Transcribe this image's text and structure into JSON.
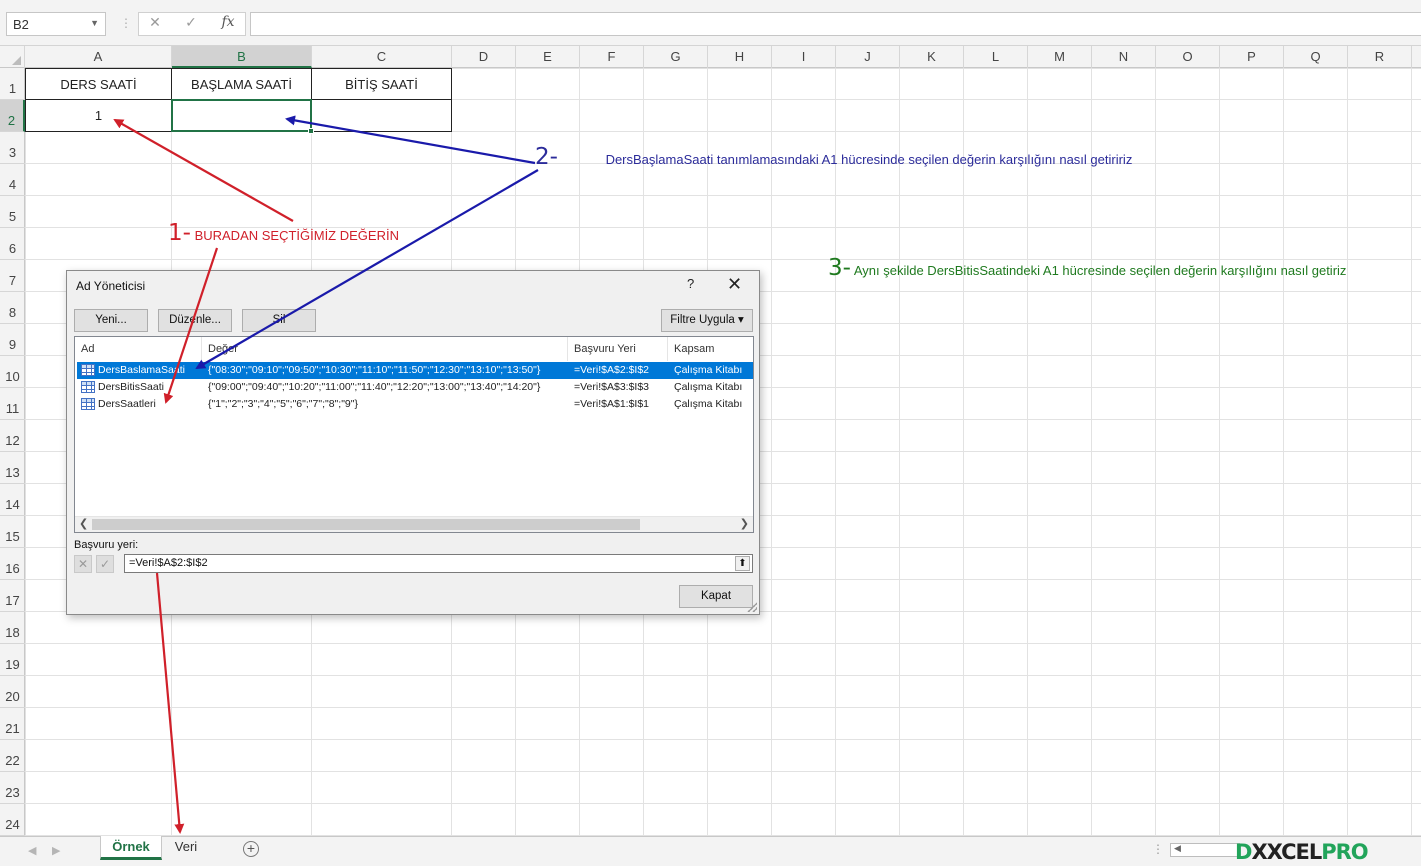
{
  "formula_bar": {
    "name_box": "B2",
    "cancel_glyph": "✕",
    "enter_glyph": "✓",
    "fx_label": "fx",
    "formula_value": ""
  },
  "columns": [
    "A",
    "B",
    "C",
    "D",
    "E",
    "F",
    "G",
    "H",
    "I",
    "J",
    "K",
    "L",
    "M",
    "N",
    "O",
    "P",
    "Q",
    "R"
  ],
  "selected_column": "B",
  "rows": [
    "1",
    "2",
    "3",
    "4",
    "5",
    "6",
    "7",
    "8",
    "9",
    "10",
    "11",
    "12",
    "13",
    "14",
    "15",
    "16",
    "17",
    "18",
    "19",
    "20",
    "21",
    "22",
    "23",
    "24"
  ],
  "selected_row": "2",
  "cells": {
    "A1": "DERS SAATİ",
    "B1": "BAŞLAMA SAATİ",
    "C1": "BİTİŞ SAATİ",
    "A2": "1",
    "B2": "",
    "C2": ""
  },
  "annotations": {
    "note1_number": "1-",
    "note1_text": "BURADAN SEÇTİĞİMİZ DEĞERİN",
    "note1_color": "#d0202a",
    "note2_number": "2-",
    "note2_text": "DersBaşlamaSaati tanımlamasındaki A1 hücresinde seçilen değerin karşılığını nasıl getiririz",
    "note2_color": "#2b2b9a",
    "note3_number": "3-",
    "note3_text": "Aynı şekilde DersBitisSaatindeki A1 hücresinde seçilen değerin karşılığını nasıl getiriz",
    "note3_color": "#1f7a1f",
    "arrow_red": "#d0202a",
    "arrow_blue": "#1a1aaa"
  },
  "dialog": {
    "title": "Ad Yöneticisi",
    "help": "?",
    "close": "✕",
    "buttons": {
      "new": "Yeni...",
      "edit": "Düzenle...",
      "delete": "Sil",
      "filter": "Filtre Uygula ▾",
      "close": "Kapat"
    },
    "columns": [
      "Ad",
      "Değer",
      "Başvuru Yeri",
      "Kapsam"
    ],
    "rows": [
      {
        "name": "DersBaslamaSaati",
        "value": "{\"08:30\";\"09:10\";\"09:50\";\"10:30\";\"11:10\";\"11:50\";\"12:30\";\"13:10\";\"13:50\"}",
        "ref": "=Veri!$A$2:$I$2",
        "scope": "Çalışma Kitabı"
      },
      {
        "name": "DersBitisSaati",
        "value": "{\"09:00\";\"09:40\";\"10:20\";\"11:00\";\"11:40\";\"12:20\";\"13:00\";\"13:40\";\"14:20\"}",
        "ref": "=Veri!$A$3:$I$3",
        "scope": "Çalışma Kitabı"
      },
      {
        "name": "DersSaatleri",
        "value": "{\"1\";\"2\";\"3\";\"4\";\"5\";\"6\";\"7\";\"8\";\"9\"}",
        "ref": "=Veri!$A$1:$I$1",
        "scope": "Çalışma Kitabı"
      }
    ],
    "selected_row": 0,
    "ref_label": "Başvuru yeri:",
    "ref_value": "=Veri!$A$2:$I$2",
    "ref_cancel": "✕",
    "ref_ok": "✓",
    "ref_collapse": "⬆"
  },
  "sheet_tabs": {
    "tabs": [
      "Örnek",
      "Veri"
    ],
    "active": "Örnek",
    "add": "+",
    "nav_prev": "◀",
    "nav_next": "▶"
  },
  "watermark": {
    "part1": "D",
    "part2": "XXCEL",
    "part3": "PRO"
  },
  "colors": {
    "excel_green": "#217346",
    "selection_blue": "#0078d7"
  }
}
